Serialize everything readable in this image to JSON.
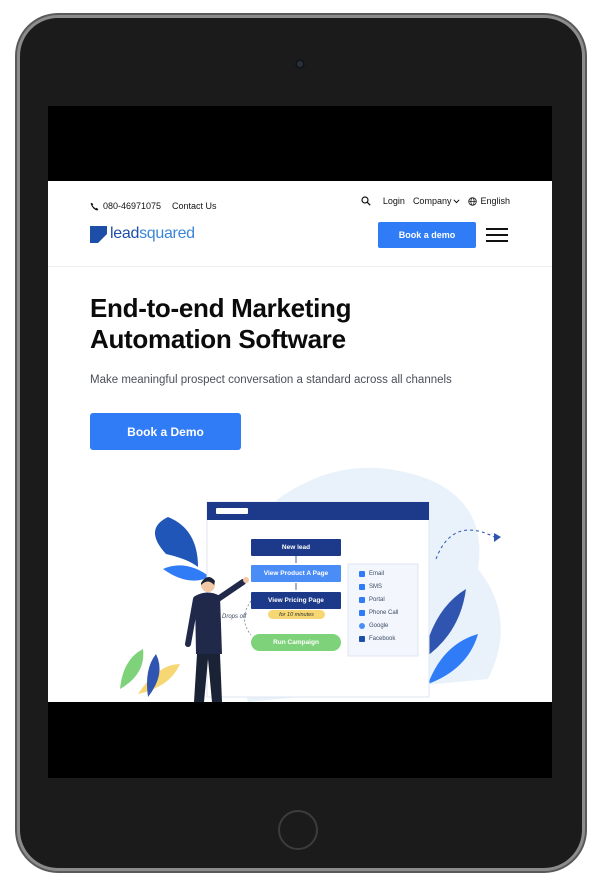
{
  "header": {
    "phone_number": "080-46971075",
    "contact_label": "Contact Us",
    "login_label": "Login",
    "company_label": "Company",
    "language_label": "English",
    "logo_text_part1": "lead",
    "logo_text_part2": "squared",
    "book_demo_label": "Book a demo"
  },
  "hero": {
    "title": "End-to-end Marketing Automation Software",
    "subtitle": "Make meaningful prospect conversation a standard across all channels",
    "cta_label": "Book a Demo"
  },
  "illustration": {
    "flow_nodes": [
      "New lead",
      "View Product A Page",
      "View Pricing Page",
      "Run Campaign"
    ],
    "wait_label": "for 10 minutes",
    "drop_label": "Drops off",
    "channels": [
      "Email",
      "SMS",
      "Portal",
      "Phone Call",
      "Google",
      "Facebook"
    ]
  },
  "colors": {
    "accent": "#2f7cf6",
    "navy": "#1d3a8a",
    "green": "#7ed27a",
    "yellow": "#f7d774"
  }
}
